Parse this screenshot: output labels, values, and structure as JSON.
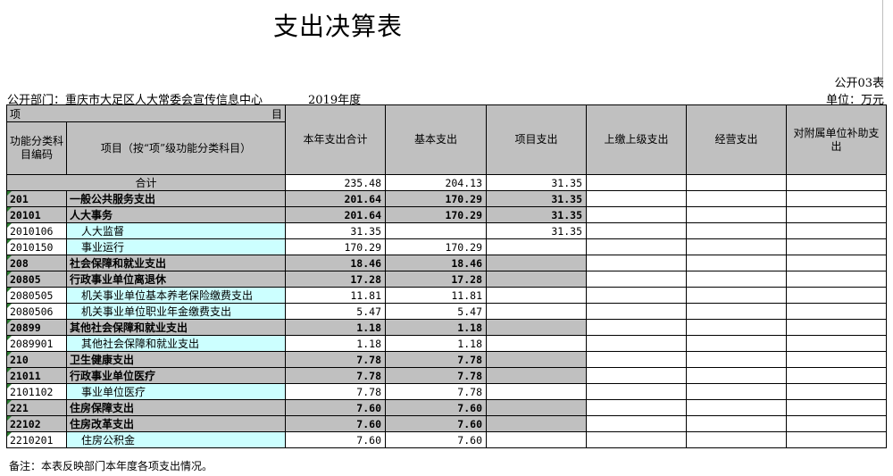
{
  "title": "支出决算表",
  "form_code": "公开03表",
  "dept_label": "公开部门：重庆市大足区人大常委会宣传信息中心",
  "year": "2019年度",
  "unit": "单位：万元",
  "header": {
    "xiang": "项",
    "mu": "目",
    "code": "功能分类科目编码",
    "item": "项目（按“项”级功能分类科目）",
    "cols": [
      "本年支出合计",
      "基本支出",
      "项目支出",
      "上缴上级支出",
      "经营支出",
      "对附属单位补助支出"
    ]
  },
  "total": {
    "label": "合计",
    "values": [
      "235.48",
      "204.13",
      "31.35",
      "",
      "",
      ""
    ]
  },
  "rows": [
    {
      "code": "201",
      "name": "一般公共服务支出",
      "values": [
        "201.64",
        "170.29",
        "31.35",
        "",
        "",
        ""
      ],
      "style": "g"
    },
    {
      "code": "20101",
      "name": "人大事务",
      "values": [
        "201.64",
        "170.29",
        "31.35",
        "",
        "",
        ""
      ],
      "style": "g"
    },
    {
      "code": "2010106",
      "name": "人大监督",
      "values": [
        "31.35",
        "",
        "31.35",
        "",
        "",
        ""
      ],
      "style": "c"
    },
    {
      "code": "2010150",
      "name": "事业运行",
      "values": [
        "170.29",
        "170.29",
        "",
        "",
        "",
        ""
      ],
      "style": "c"
    },
    {
      "code": "208",
      "name": "社会保障和就业支出",
      "values": [
        "18.46",
        "18.46",
        "",
        "",
        "",
        ""
      ],
      "style": "g"
    },
    {
      "code": "20805",
      "name": "行政事业单位离退休",
      "values": [
        "17.28",
        "17.28",
        "",
        "",
        "",
        ""
      ],
      "style": "g"
    },
    {
      "code": "2080505",
      "name": "机关事业单位基本养老保险缴费支出",
      "values": [
        "11.81",
        "11.81",
        "",
        "",
        "",
        ""
      ],
      "style": "c"
    },
    {
      "code": "2080506",
      "name": "机关事业单位职业年金缴费支出",
      "values": [
        "5.47",
        "5.47",
        "",
        "",
        "",
        ""
      ],
      "style": "c"
    },
    {
      "code": "20899",
      "name": "其他社会保障和就业支出",
      "values": [
        "1.18",
        "1.18",
        "",
        "",
        "",
        ""
      ],
      "style": "g"
    },
    {
      "code": "2089901",
      "name": "其他社会保障和就业支出",
      "values": [
        "1.18",
        "1.18",
        "",
        "",
        "",
        ""
      ],
      "style": "c"
    },
    {
      "code": "210",
      "name": "卫生健康支出",
      "values": [
        "7.78",
        "7.78",
        "",
        "",
        "",
        ""
      ],
      "style": "g"
    },
    {
      "code": "21011",
      "name": "行政事业单位医疗",
      "values": [
        "7.78",
        "7.78",
        "",
        "",
        "",
        ""
      ],
      "style": "g"
    },
    {
      "code": "2101102",
      "name": "事业单位医疗",
      "values": [
        "7.78",
        "7.78",
        "",
        "",
        "",
        ""
      ],
      "style": "c"
    },
    {
      "code": "221",
      "name": "住房保障支出",
      "values": [
        "7.60",
        "7.60",
        "",
        "",
        "",
        ""
      ],
      "style": "g"
    },
    {
      "code": "22102",
      "name": "住房改革支出",
      "values": [
        "7.60",
        "7.60",
        "",
        "",
        "",
        ""
      ],
      "style": "g"
    },
    {
      "code": "2210201",
      "name": "住房公积金",
      "values": [
        "7.60",
        "7.60",
        "",
        "",
        "",
        ""
      ],
      "style": "c"
    }
  ],
  "note": "备注：本表反映部门本年度各项支出情况。"
}
